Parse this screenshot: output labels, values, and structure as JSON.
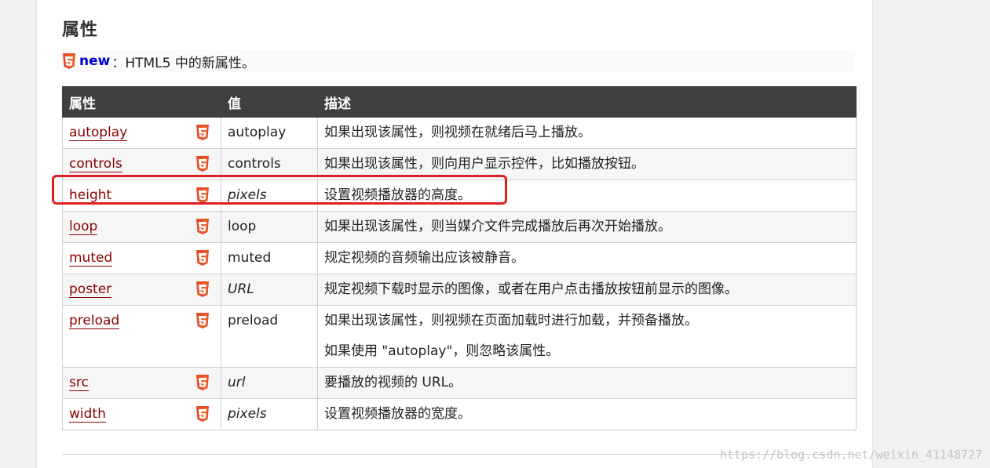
{
  "section": {
    "heading": "属性",
    "note_keyword": "new",
    "note_text": "：HTML5 中的新属性。"
  },
  "table": {
    "headers": [
      "属性",
      "值",
      "描述"
    ],
    "rows": [
      {
        "attr": "autoplay",
        "value": "autoplay",
        "value_italic": false,
        "desc": [
          "如果出现该属性，则视频在就绪后马上播放。"
        ]
      },
      {
        "attr": "controls",
        "value": "controls",
        "value_italic": false,
        "desc": [
          "如果出现该属性，则向用户显示控件，比如播放按钮。"
        ]
      },
      {
        "attr": "height",
        "value": "pixels",
        "value_italic": true,
        "desc": [
          "设置视频播放器的高度。"
        ]
      },
      {
        "attr": "loop",
        "value": "loop",
        "value_italic": false,
        "desc": [
          "如果出现该属性，则当媒介文件完成播放后再次开始播放。"
        ]
      },
      {
        "attr": "muted",
        "value": "muted",
        "value_italic": false,
        "desc": [
          "规定视频的音频输出应该被静音。"
        ]
      },
      {
        "attr": "poster",
        "value": "URL",
        "value_italic": true,
        "desc": [
          "规定视频下载时显示的图像，或者在用户点击播放按钮前显示的图像。"
        ]
      },
      {
        "attr": "preload",
        "value": "preload",
        "value_italic": false,
        "desc": [
          "如果出现该属性，则视频在页面加载时进行加载，并预备播放。",
          "如果使用 \"autoplay\"，则忽略该属性。"
        ]
      },
      {
        "attr": "src",
        "value": "url",
        "value_italic": true,
        "desc": [
          "要播放的视频的 URL。"
        ]
      },
      {
        "attr": "width",
        "value": "pixels",
        "value_italic": true,
        "desc": [
          "设置视频播放器的宽度。"
        ]
      }
    ]
  },
  "highlighted_row": "height",
  "watermark": "https://blog.csdn.net/weixin_41148727",
  "colors": {
    "header_bg": "#404040",
    "link": "#8b0000",
    "new_keyword": "#0000cc",
    "html5_badge": "#e44d26",
    "highlight_box": "#e02020"
  },
  "icons": {
    "html5": "html5-badge-icon"
  }
}
